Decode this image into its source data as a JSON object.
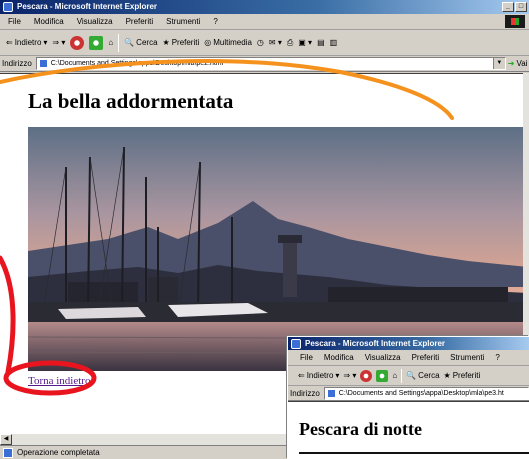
{
  "window1": {
    "title": "Pescara - Microsoft Internet Explorer",
    "menu": [
      "File",
      "Modifica",
      "Visualizza",
      "Preferiti",
      "Strumenti",
      "?"
    ],
    "toolbar": {
      "back": "Indietro",
      "search": "Cerca",
      "favorites": "Preferiti",
      "multimedia": "Multimedia"
    },
    "address_label": "Indirizzo",
    "address_value": "C:\\Documents and Settings\\appa\\Desktop\\mla\\pe2.html",
    "go_label": "Vai",
    "heading": "La bella addormentata",
    "link": "Torna indietro",
    "status": "Operazione completata"
  },
  "window2": {
    "title": "Pescara - Microsoft Internet Explorer",
    "menu": [
      "File",
      "Modifica",
      "Visualizza",
      "Preferiti",
      "Strumenti",
      "?"
    ],
    "toolbar": {
      "back": "Indietro",
      "search": "Cerca",
      "favorites": "Preferiti"
    },
    "address_label": "Indirizzo",
    "address_value": "C:\\Documents and Settings\\appa\\Desktop\\mla\\pe3.ht",
    "heading": "Pescara di notte"
  },
  "colors": {
    "annotation_orange": "#f5921e",
    "annotation_red": "#e8141e",
    "titlebar": "#0a246a",
    "link_visited": "#551a8b"
  }
}
